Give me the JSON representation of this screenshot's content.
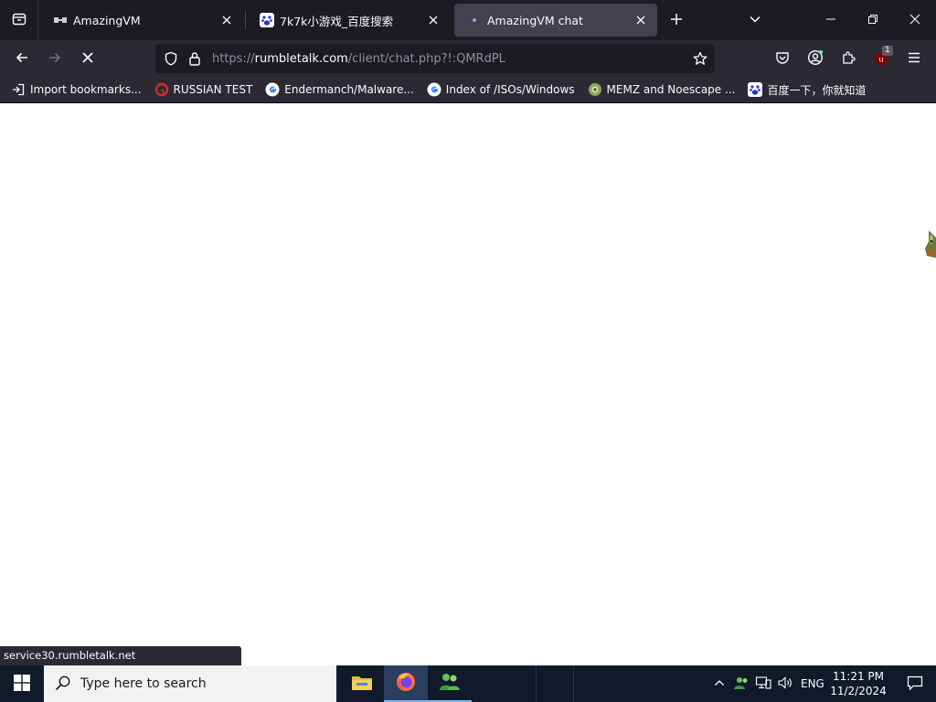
{
  "browser": {
    "tabs": [
      {
        "title": "AmazingVM",
        "favicon": "amazingvm-icon",
        "active": false
      },
      {
        "title": "7k7k小游戏_百度搜索",
        "favicon": "baidu-paw-icon",
        "active": false
      },
      {
        "title": "AmazingVM chat",
        "favicon": "loading-dot-icon",
        "active": true
      }
    ],
    "url": {
      "scheme": "https://",
      "host": "rumbletalk.com",
      "path": "/client/chat.php?!:QMRdPL"
    },
    "extension_badge": "1",
    "bookmarks": [
      {
        "label": "Import bookmarks...",
        "icon": "import-icon"
      },
      {
        "label": "RUSSIAN TEST",
        "icon": "red-circle-icon"
      },
      {
        "label": "Endermanch/Malware...",
        "icon": "google-g-icon"
      },
      {
        "label": "Index of /ISOs/Windows",
        "icon": "google-g-icon"
      },
      {
        "label": "MEMZ and Noescape ...",
        "icon": "green-globe-icon"
      },
      {
        "label": "百度一下，你就知道",
        "icon": "baidu-paw-icon"
      }
    ],
    "status_text": "service30.rumbletalk.net"
  },
  "taskbar": {
    "search_placeholder": "Type here to search",
    "apps": [
      {
        "name": "file-explorer-icon",
        "state": "normal"
      },
      {
        "name": "firefox-icon",
        "state": "active"
      },
      {
        "name": "users-chat-icon",
        "state": "open"
      }
    ],
    "language": "ENG",
    "time": "11:21 PM",
    "date": "11/2/2024"
  },
  "colors": {
    "toolbar_bg": "#2b2a33",
    "tabstrip_bg": "#1c1b22",
    "taskbar_bg": "#101a2b",
    "accent": "#7fb3ec"
  }
}
